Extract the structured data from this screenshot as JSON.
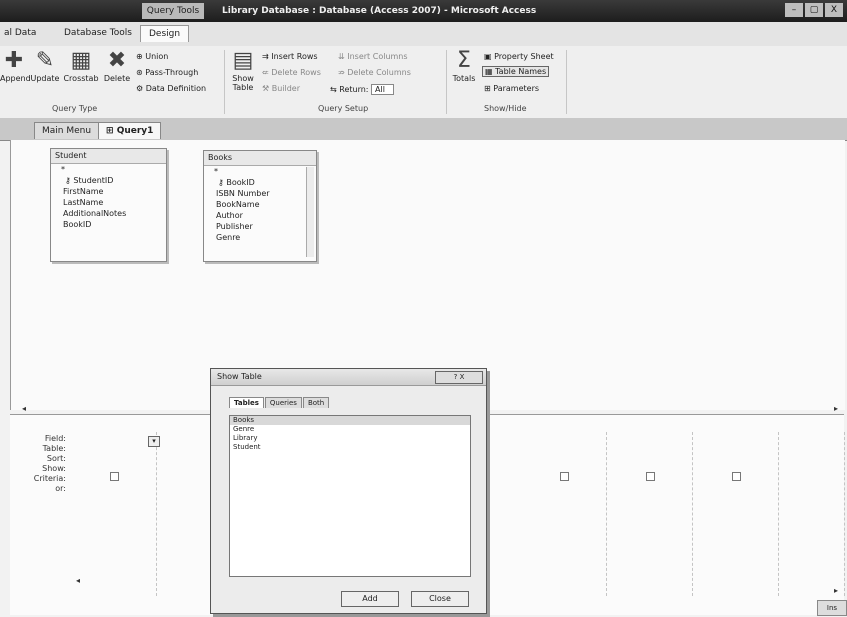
{
  "window": {
    "context_tab": "Query Tools",
    "title": "Library Database : Database (Access 2007) - Microsoft Access",
    "controls": [
      "–",
      "▢",
      "X"
    ]
  },
  "ribbon_tabs": [
    "al Data",
    "Database Tools",
    "Design"
  ],
  "ribbon": {
    "query_type": {
      "caption": "Query Type",
      "buttons": [
        "Append",
        "Update",
        "Crosstab",
        "Delete"
      ],
      "small": [
        "Union",
        "Pass-Through",
        "Data Definition"
      ]
    },
    "query_setup": {
      "caption": "Query Setup",
      "show_table": "Show Table",
      "rows": [
        "Insert Rows",
        "Insert Columns",
        "Delete Rows",
        "Delete Columns",
        "Builder",
        "Return:",
        "All"
      ]
    },
    "show_hide": {
      "caption": "Show/Hide",
      "totals": "Totals",
      "rows": [
        "Property Sheet",
        "Table Names",
        "Parameters"
      ]
    }
  },
  "doc_tabs": [
    "Main Menu",
    "Query1"
  ],
  "tables": [
    {
      "name": "Student",
      "fields": [
        "*",
        "StudentID",
        "FirstName",
        "LastName",
        "AdditionalNotes",
        "BookID"
      ]
    },
    {
      "name": "Books",
      "fields": [
        "*",
        "BookID",
        "ISBN Number",
        "BookName",
        "Author",
        "Publisher",
        "Genre"
      ]
    }
  ],
  "grid_rows": [
    "Field:",
    "Table:",
    "Sort:",
    "Show:",
    "Criteria:",
    "or:"
  ],
  "dialog": {
    "title": "Show Table",
    "close": "? X",
    "tabs": [
      "Tables",
      "Queries",
      "Both"
    ],
    "items": [
      "Books",
      "Genre",
      "Library",
      "Student"
    ],
    "buttons": [
      "Add",
      "Close"
    ]
  },
  "status": "Ins"
}
